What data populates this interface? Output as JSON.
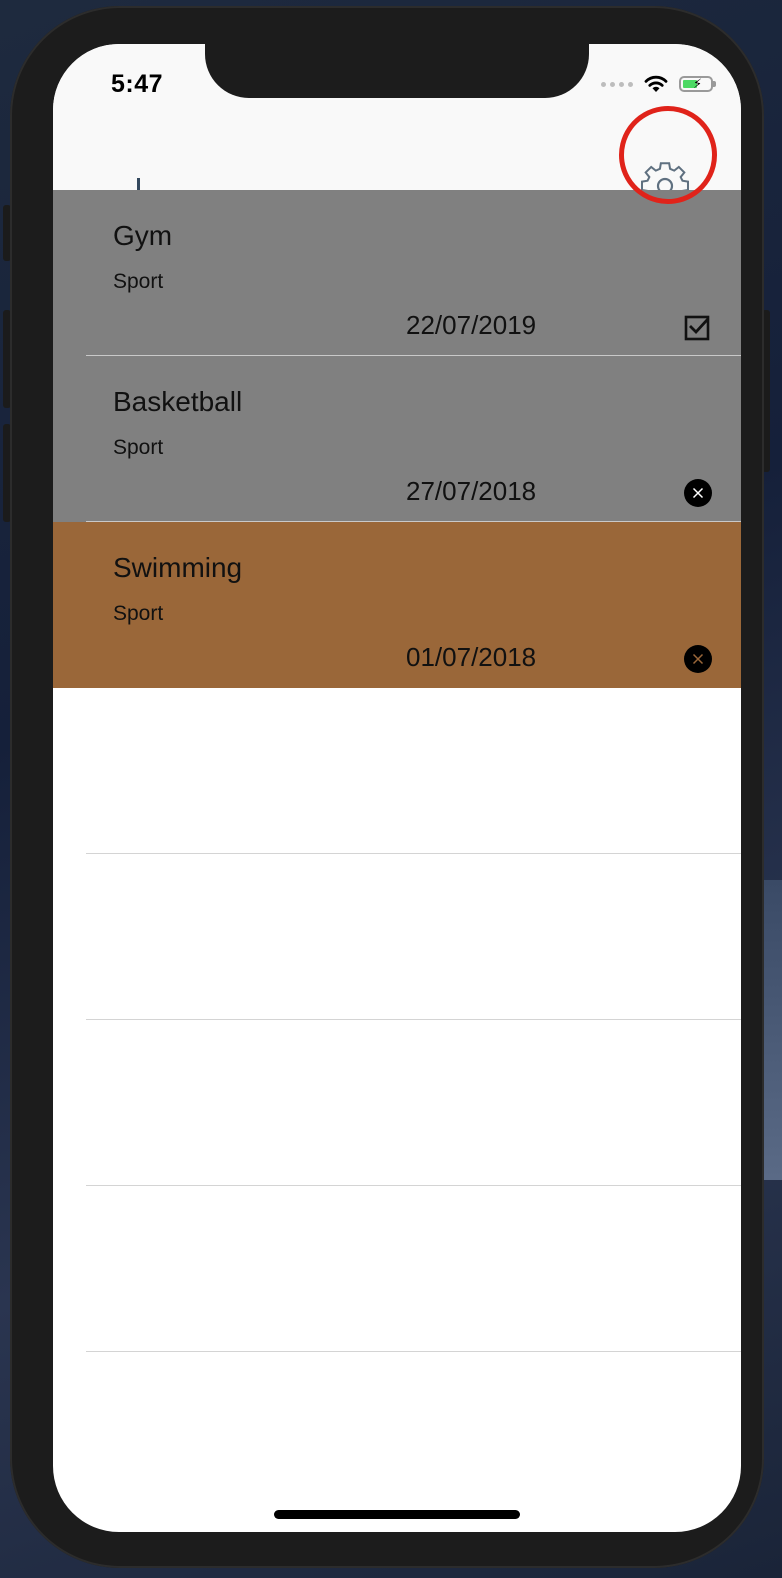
{
  "status_bar": {
    "time": "5:47",
    "battery_color": "#4cd964"
  },
  "navbar": {
    "add_icon": "plus-icon",
    "settings_icon": "gear-icon",
    "highlight_color": "#e0231a"
  },
  "items": [
    {
      "title": "Gym",
      "category": "Sport",
      "date": "22/07/2019",
      "status": "done",
      "status_icon": "checkbox-checked-icon",
      "row_color": "#808080"
    },
    {
      "title": "Basketball",
      "category": "Sport",
      "date": "27/07/2018",
      "status": "missed",
      "status_icon": "x-circle-icon",
      "row_color": "#808080"
    },
    {
      "title": "Swimming",
      "category": "Sport",
      "date": "01/07/2018",
      "status": "missed",
      "status_icon": "x-circle-icon",
      "row_color": "#9a6739"
    }
  ]
}
